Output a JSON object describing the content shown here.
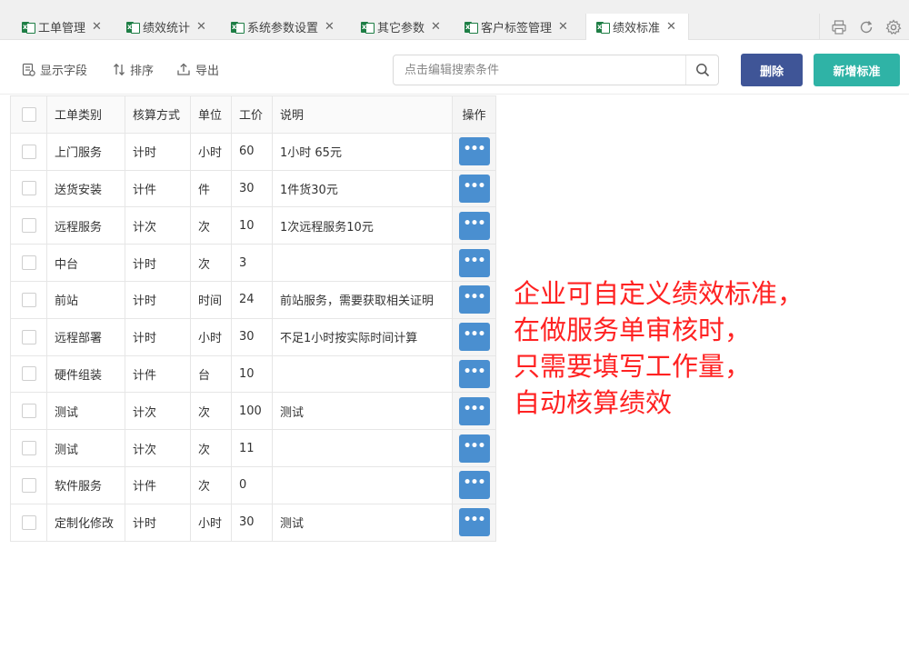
{
  "tabs": [
    {
      "label": "工单管理",
      "active": false
    },
    {
      "label": "绩效统计",
      "active": false
    },
    {
      "label": "系统参数设置",
      "active": false
    },
    {
      "label": "其它参数",
      "active": false
    },
    {
      "label": "客户标签管理",
      "active": false
    },
    {
      "label": "绩效标准",
      "active": true
    }
  ],
  "tab_icon": "excel-icon",
  "tab_close_glyph": "✕",
  "tab_icon_letter": "x",
  "toolbar": {
    "show_fields": "显示字段",
    "sort": "排序",
    "export": "导出",
    "search_placeholder": "点击编辑搜索条件",
    "delete_label": "删除",
    "add_label": "新增标准"
  },
  "table": {
    "headers": [
      "工单类别",
      "核算方式",
      "单位",
      "工价",
      "说明",
      "操作"
    ],
    "rows": [
      [
        "上门服务",
        "计时",
        "小时",
        "60",
        "1小时 65元"
      ],
      [
        "送货安装",
        "计件",
        "件",
        "30",
        "1件货30元"
      ],
      [
        "远程服务",
        "计次",
        "次",
        "10",
        "1次远程服务10元"
      ],
      [
        "中台",
        "计时",
        "次",
        "3",
        ""
      ],
      [
        "前站",
        "计时",
        "时间",
        "24",
        "前站服务，需要获取相关证明"
      ],
      [
        "远程部署",
        "计时",
        "小时",
        "30",
        "不足1小时按实际时间计算"
      ],
      [
        "硬件组装",
        "计件",
        "台",
        "10",
        ""
      ],
      [
        "测试",
        "计次",
        "次",
        "100",
        "测试"
      ],
      [
        "测试",
        "计次",
        "次",
        "11",
        ""
      ],
      [
        "软件服务",
        "计件",
        "次",
        "0",
        ""
      ],
      [
        "定制化修改",
        "计时",
        "小时",
        "30",
        "测试"
      ]
    ],
    "op_glyph": "•••"
  },
  "annotation": [
    "企业可自定义绩效标准，",
    "在做服务单审核时，",
    "只需要填写工作量，",
    "自动核算绩效"
  ],
  "colors": {
    "delete_button": "#3f5597",
    "add_button": "#2fb3a6",
    "op_button": "#4a8fd0",
    "annotation_text": "#ff2222",
    "excel_icon": "#1e7e45"
  },
  "icons": {
    "show_fields": "field-list-icon",
    "sort": "sort-icon",
    "export": "export-icon",
    "search": "search-icon",
    "print": "print-icon",
    "refresh": "refresh-icon",
    "settings": "gear-icon"
  }
}
